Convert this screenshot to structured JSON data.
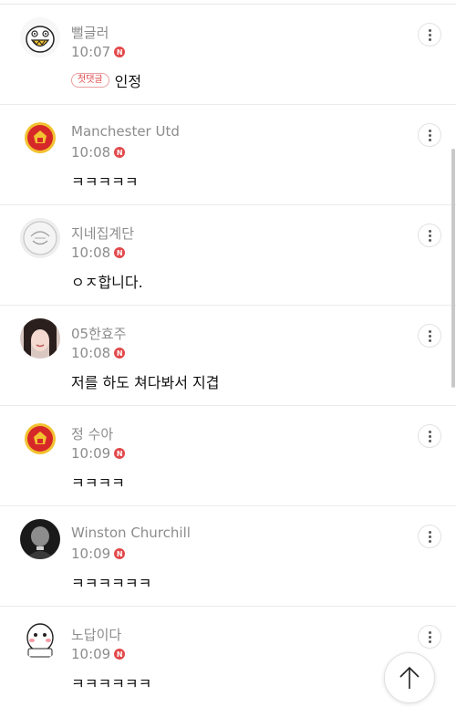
{
  "colors": {
    "accent": "#e2494b",
    "meta_text": "#8c8c8c",
    "divider": "#ebebeb"
  },
  "badge_label": "N",
  "first_comment_tag": "첫댓글",
  "comments": [
    {
      "username": "뻘글러",
      "time": "10:07",
      "text": "인정",
      "avatar": "cartoon-monster",
      "first_comment": true
    },
    {
      "username": "Manchester Utd",
      "time": "10:08",
      "text": "ㅋㅋㅋㅋㅋ",
      "avatar": "manchester-united-crest"
    },
    {
      "username": "지네집계단",
      "time": "10:08",
      "text": "ㅇㅈ합니다.",
      "avatar": "line-drawing-face"
    },
    {
      "username": "05한효주",
      "time": "10:08",
      "text": "저를 하도 쳐다봐서 지겹",
      "avatar": "woman-photo"
    },
    {
      "username": "정 수아",
      "time": "10:09",
      "text": "ㅋㅋㅋㅋ",
      "avatar": "manchester-united-crest"
    },
    {
      "username": "Winston Churchill",
      "time": "10:09",
      "text": "ㅋㅋㅋㅋㅋㅋ",
      "avatar": "churchill-photo"
    },
    {
      "username": "노답이다",
      "time": "10:09",
      "text": "ㅋㅋㅋㅋㅋㅋ",
      "avatar": "cartoon-ghost"
    }
  ],
  "scroll_to_top_icon": "arrow-up-icon"
}
